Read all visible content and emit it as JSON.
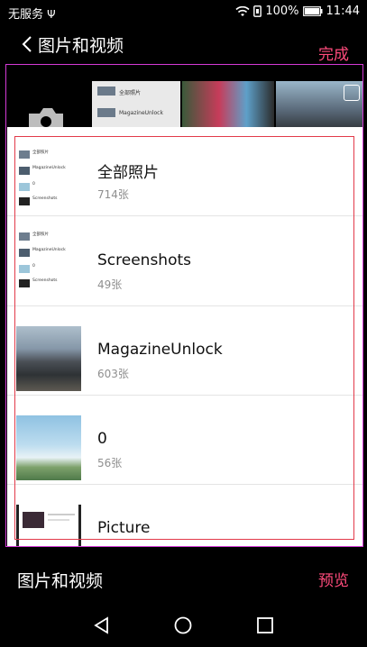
{
  "status_bar": {
    "carrier": "无服务",
    "battery": "100%",
    "time": "11:44"
  },
  "header": {
    "title": "图片和视频",
    "done_label": "完成"
  },
  "strip": {
    "thumb_label_1": "全部照片",
    "thumb_label_2": "MagazineUnlock"
  },
  "albums": [
    {
      "name": "全部照片",
      "count": "714张",
      "thumb": "album-list"
    },
    {
      "name": "Screenshots",
      "count": "49张",
      "thumb": "album-list"
    },
    {
      "name": "MagazineUnlock",
      "count": "603张",
      "thumb": "mountain"
    },
    {
      "name": "0",
      "count": "56张",
      "thumb": "sky"
    },
    {
      "name": "Picture",
      "count": "",
      "thumb": "picture"
    }
  ],
  "mini_list": [
    {
      "title": "全部照片"
    },
    {
      "title": "MagazineUnlock"
    },
    {
      "title": "0"
    },
    {
      "title": "Screenshots"
    }
  ],
  "bottom_bar": {
    "title": "图片和视频",
    "preview_label": "预览"
  },
  "colors": {
    "accent": "#ff4b7c",
    "outline_outer": "#d43ad6",
    "outline_inner": "#e23a4a"
  },
  "icons": {
    "back": "chevron-left-icon",
    "camera": "camera-icon",
    "nav_back": "triangle-back-icon",
    "nav_home": "circle-home-icon",
    "nav_recent": "square-recent-icon"
  }
}
